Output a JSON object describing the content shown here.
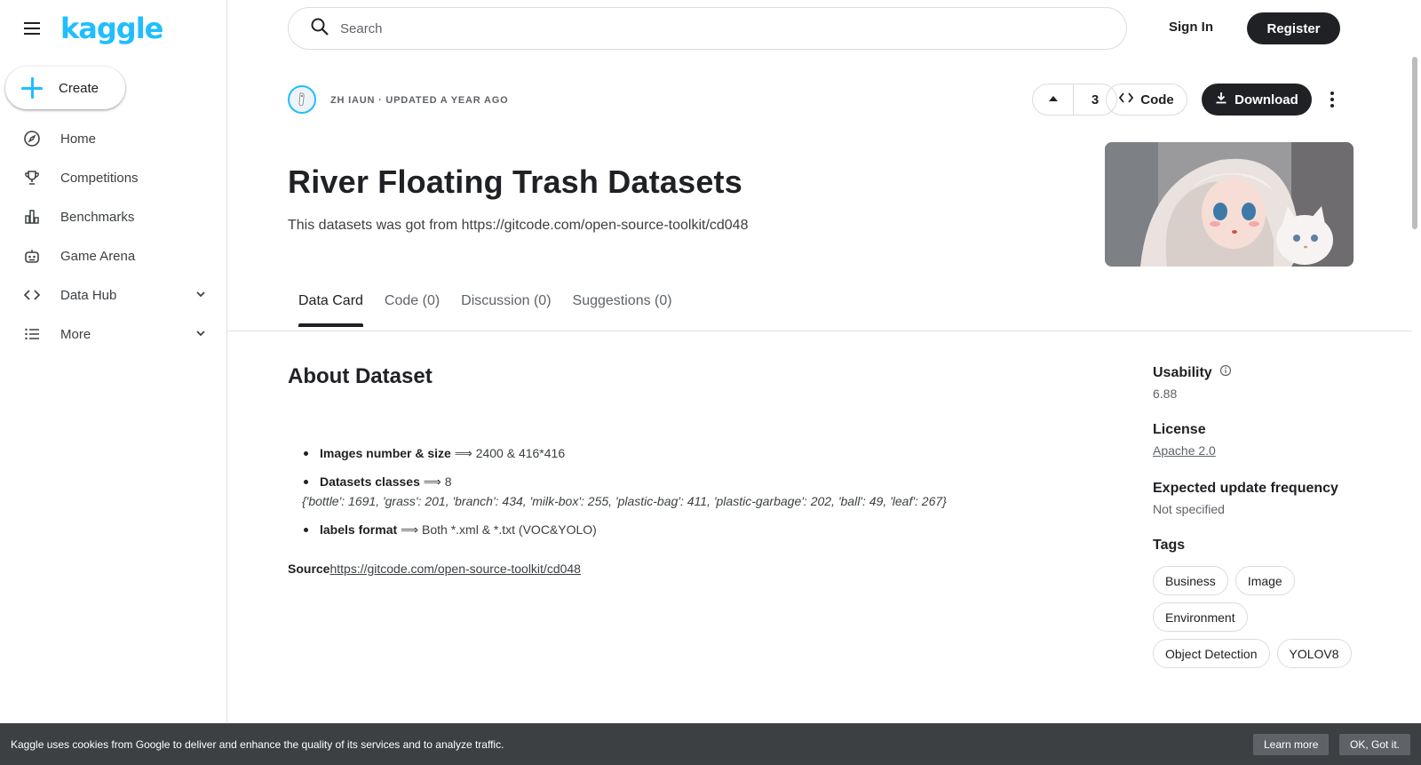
{
  "sidebar": {
    "logo": "kaggle",
    "create_label": "Create",
    "items": [
      {
        "label": "Home",
        "icon": "compass-icon"
      },
      {
        "label": "Competitions",
        "icon": "trophy-icon"
      },
      {
        "label": "Benchmarks",
        "icon": "bar-chart-icon"
      },
      {
        "label": "Game Arena",
        "icon": "robot-icon"
      },
      {
        "label": "Data Hub",
        "icon": "code-brackets-icon"
      },
      {
        "label": "More",
        "icon": "list-icon"
      }
    ]
  },
  "header": {
    "search_placeholder": "Search",
    "sign_in": "Sign In",
    "register": "Register"
  },
  "dataset": {
    "author_line": "ZH IAUN · UPDATED A YEAR AGO",
    "vote_count": "3",
    "code_label": "Code",
    "download_label": "Download",
    "title": "River Floating Trash Datasets",
    "subtitle": "This datasets was got from https://gitcode.com/open-source-toolkit/cd048"
  },
  "tabs": [
    "Data Card",
    "Code (0)",
    "Discussion (0)",
    "Suggestions (0)"
  ],
  "about": {
    "heading": "About Dataset",
    "bullets": [
      {
        "label": "Images number & size",
        "arrow": "⟹",
        "value": "2400 & 416*416"
      },
      {
        "label": "Datasets classes",
        "arrow": "⟹",
        "value": "8"
      },
      {
        "label": "labels format",
        "arrow": "⟹",
        "value": "Both *.xml & *.txt (VOC&YOLO)"
      }
    ],
    "classes_line": "{'bottle': 1691, 'grass': 201, 'branch': 434, 'milk-box': 255, 'plastic-bag': 411, 'plastic-garbage': 202, 'ball': 49, 'leaf': 267}",
    "source_label": "Source",
    "source_link": "https://gitcode.com/open-source-toolkit/cd048"
  },
  "panel": {
    "usability_label": "Usability",
    "usability_value": "6.88",
    "license_label": "License",
    "license_value": "Apache 2.0",
    "freq_label": "Expected update frequency",
    "freq_value": "Not specified",
    "tags_label": "Tags",
    "tags": [
      "Business",
      "Image",
      "Environment",
      "Object Detection",
      "YOLOV8"
    ]
  },
  "cookie": {
    "message": "Kaggle uses cookies from Google to deliver and enhance the quality of its services and to analyze traffic.",
    "learn_more": "Learn more",
    "ok": "OK, Got it."
  },
  "colors": {
    "brand": "#20beff",
    "dark": "#202124",
    "banner": "#3c4043"
  }
}
